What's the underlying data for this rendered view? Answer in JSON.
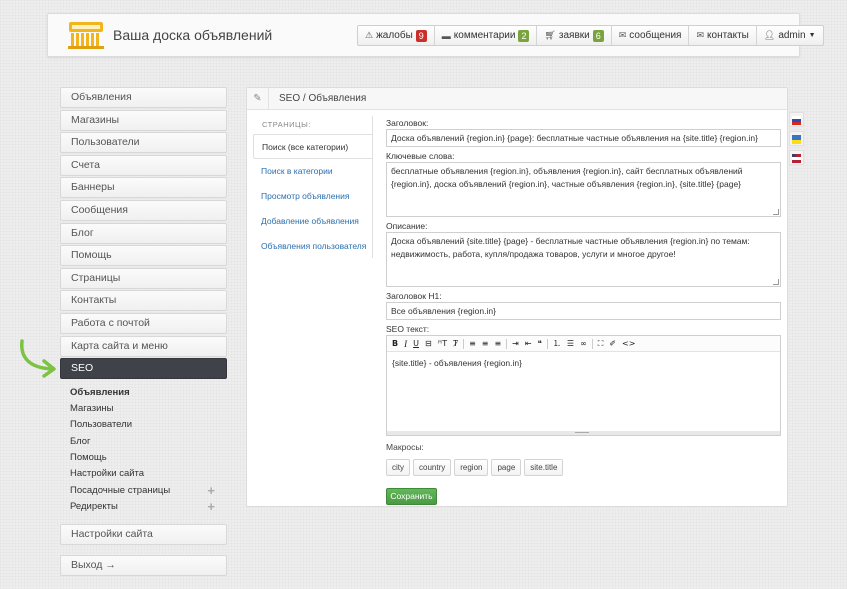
{
  "header": {
    "site_title": "Ваша доска объявлений",
    "nav": [
      {
        "icon": "warning-icon",
        "label": "жалобы",
        "badge": "9",
        "badge_color": "#c9302c"
      },
      {
        "icon": "comment-icon",
        "label": "комментарии",
        "badge": "2",
        "badge_color": "#7aa33f"
      },
      {
        "icon": "cart-icon",
        "label": "заявки",
        "badge": "6",
        "badge_color": "#7aa33f"
      },
      {
        "icon": "envelope-icon",
        "label": "сообщения"
      },
      {
        "icon": "envelope-icon",
        "label": "контакты"
      },
      {
        "icon": "user-icon",
        "label": "admin"
      }
    ]
  },
  "sidebar": {
    "items": [
      "Объявления",
      "Магазины",
      "Пользователи",
      "Счета",
      "Баннеры",
      "Сообщения",
      "Блог",
      "Помощь",
      "Страницы",
      "Контакты",
      "Работа с почтой",
      "Карта сайта и меню"
    ],
    "active": "SEO",
    "sub_items": [
      "Объявления",
      "Магазины",
      "Пользователи",
      "Блог",
      "Помощь",
      "Настройки сайта",
      "Посадочные страницы",
      "Редиректы"
    ],
    "settings": "Настройки сайта",
    "logout": "Выход →"
  },
  "panel": {
    "breadcrumb": "SEO / Объявления",
    "pages_label": "СТРАНИЦЫ:",
    "tabs": [
      "Поиск (все категории)",
      "Поиск в категории",
      "Просмотр объявления",
      "Добавление объявления",
      "Объявления пользователя"
    ],
    "form": {
      "title_label": "Заголовок:",
      "title_value": "Доска объявлений {region.in} {page}: бесплатные частные объявления на {site.title} {region.in}",
      "keywords_label": "Ключевые слова:",
      "keywords_value": "бесплатные объявления {region.in}, объявления {region.in}, сайт бесплатных объявлений {region.in}, доска объявлений {region.in}, частные объявления {region.in}, {site.title} {page}",
      "description_label": "Описание:",
      "description_value": "Доска объявлений {site.title} {page} - бесплатные частные объявления {region.in} по темам: недвижимость, работа, купля/продажа товаров, услуги и многое другое!",
      "h1_label": "Заголовок H1:",
      "h1_value": "Все объявления {region.in}",
      "seotext_label": "SEO текст:",
      "seotext_value": "{site.title} - объявления {region.in}",
      "macros_label": "Макросы:",
      "macros": [
        "city",
        "country",
        "region",
        "page",
        "site.title"
      ],
      "save_label": "Сохранить"
    }
  },
  "languages": [
    "ru-flag-icon",
    "ua-flag-icon",
    "us-flag-icon"
  ]
}
